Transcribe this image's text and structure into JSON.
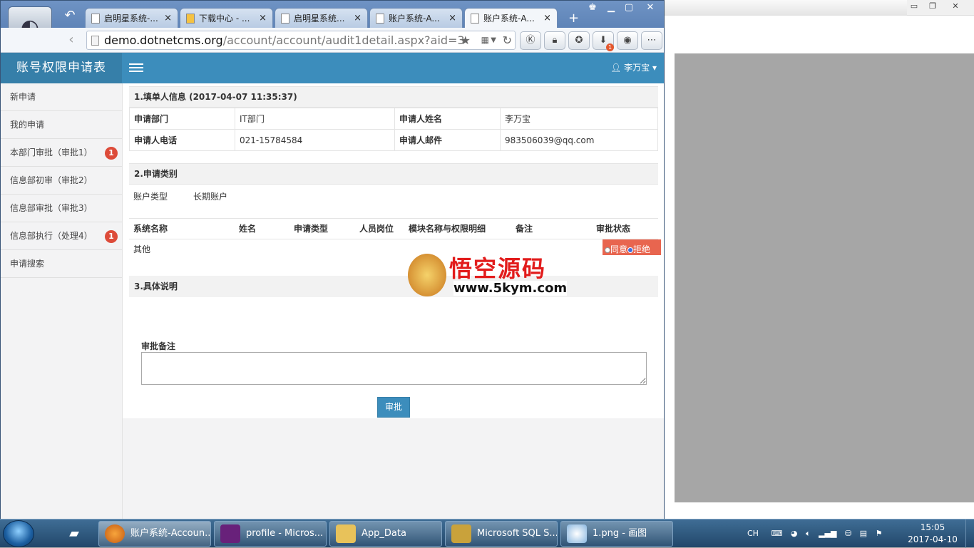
{
  "browser": {
    "back_icon": "↶",
    "tabs": [
      {
        "label": "启明星系统-..."
      },
      {
        "label": "下载中心 - ..."
      },
      {
        "label": "启明星系统..."
      },
      {
        "label": "账户系统-A..."
      },
      {
        "label": "账户系统-A..."
      }
    ],
    "tab_close": "×",
    "new_tab": "+",
    "url_host": "demo.dotnetcms.org",
    "url_path": "/account/account/audit1detail.aspx?aid=3",
    "download_badge": "1"
  },
  "app": {
    "brand": "账号权限申请表",
    "user": "李万宝"
  },
  "sidebar": {
    "items": [
      {
        "label": "新申请",
        "badge": ""
      },
      {
        "label": "我的申请",
        "badge": ""
      },
      {
        "label": "本部门审批（审批1）",
        "badge": "1"
      },
      {
        "label": "信息部初审（审批2）",
        "badge": ""
      },
      {
        "label": "信息部审批（审批3）",
        "badge": ""
      },
      {
        "label": "信息部执行（处理4）",
        "badge": "1"
      },
      {
        "label": "申请搜索",
        "badge": ""
      }
    ]
  },
  "section1": {
    "title": "1.填单人信息 (2017-04-07 11:35:37)",
    "rows": [
      {
        "l1": "申请部门",
        "v1": "IT部门",
        "l2": "申请人姓名",
        "v2": "李万宝"
      },
      {
        "l1": "申请人电话",
        "v1": "021-15784584",
        "l2": "申请人邮件",
        "v2": "983506039@qq.com"
      }
    ]
  },
  "section2": {
    "title": "2.申请类别",
    "account_type_label": "账户类型",
    "account_type_value": "长期账户",
    "columns": [
      "系统名称",
      "姓名",
      "申请类型",
      "人员岗位",
      "模块名称与权限明细",
      "备注",
      "审批状态"
    ],
    "row": {
      "system": "其他"
    },
    "status_agree": "同意",
    "status_reject": "拒绝"
  },
  "section3": {
    "title": "3.具体说明",
    "remark_label": "审批备注",
    "submit": "审批"
  },
  "watermark": {
    "title": "悟空源码",
    "url": "www.5kym.com"
  },
  "taskbar": {
    "tasks": [
      {
        "label": "账户系统-Accoun..."
      },
      {
        "label": "profile - Micros..."
      },
      {
        "label": "App_Data"
      },
      {
        "label": "Microsoft SQL S..."
      },
      {
        "label": "1.png - 画图"
      }
    ],
    "lang": "CH",
    "time": "15:05",
    "date": "2017-04-10"
  }
}
